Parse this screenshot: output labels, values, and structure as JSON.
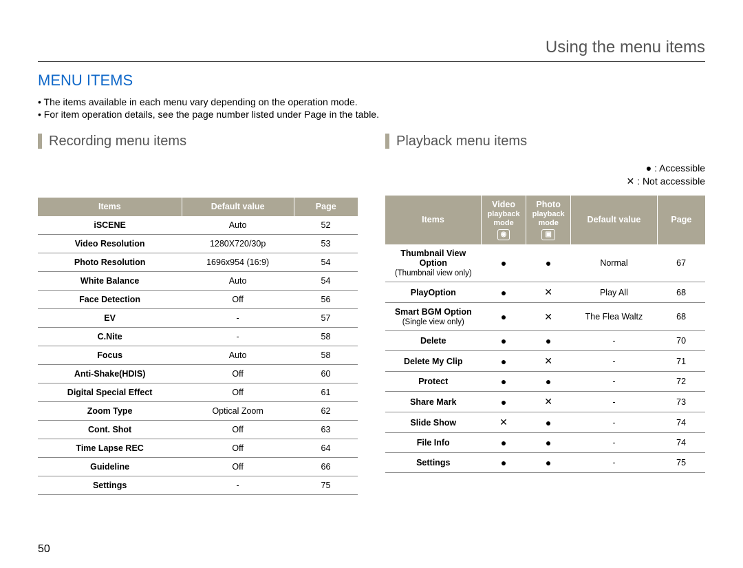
{
  "header": {
    "top_title": "Using the menu items",
    "section_title": "MENU ITEMS"
  },
  "bullets": [
    "The items available in each menu vary depending on the operation mode.",
    "For item operation details, see the page number listed under Page in the table."
  ],
  "page_number": "50",
  "left": {
    "title": "Recording menu items",
    "headers": {
      "c1": "Items",
      "c2": "Default value",
      "c3": "Page"
    },
    "rows": [
      {
        "item": "iSCENE",
        "value": "Auto",
        "page": "52"
      },
      {
        "item": "Video Resolution",
        "value": "1280X720/30p",
        "page": "53"
      },
      {
        "item": "Photo Resolution",
        "value": "1696x954 (16:9)",
        "page": "54"
      },
      {
        "item": "White Balance",
        "value": "Auto",
        "page": "54"
      },
      {
        "item": "Face Detection",
        "value": "Off",
        "page": "56"
      },
      {
        "item": "EV",
        "value": "-",
        "page": "57"
      },
      {
        "item": "C.Nite",
        "value": "-",
        "page": "58"
      },
      {
        "item": "Focus",
        "value": "Auto",
        "page": "58"
      },
      {
        "item": "Anti-Shake(HDIS)",
        "value": "Off",
        "page": "60"
      },
      {
        "item": "Digital Special Effect",
        "value": "Off",
        "page": "61"
      },
      {
        "item": "Zoom Type",
        "value": "Optical Zoom",
        "page": "62"
      },
      {
        "item": "Cont. Shot",
        "value": "Off",
        "page": "63"
      },
      {
        "item": "Time Lapse REC",
        "value": "Off",
        "page": "64"
      },
      {
        "item": "Guideline",
        "value": "Off",
        "page": "66"
      },
      {
        "item": "Settings",
        "value": "-",
        "page": "75"
      }
    ]
  },
  "right": {
    "title": "Playback menu items",
    "legend": {
      "accessible": "● : Accessible",
      "not_accessible": "✕ : Not accessible"
    },
    "headers": {
      "c1": "Items",
      "c2a": "Video",
      "c2b": "playback",
      "c2c": "mode",
      "c3a": "Photo",
      "c3b": "playback",
      "c3c": "mode",
      "c4": "Default value",
      "c5": "Page"
    },
    "rows": [
      {
        "item": "Thumbnail View Option",
        "note": "(Thumbnail view only)",
        "v": "●",
        "p": "●",
        "def": "Normal",
        "page": "67"
      },
      {
        "item": "PlayOption",
        "note": "",
        "v": "●",
        "p": "✕",
        "def": "Play All",
        "page": "68"
      },
      {
        "item": "Smart BGM Option",
        "note": "(Single view only)",
        "v": "●",
        "p": "✕",
        "def": "The Flea Waltz",
        "page": "68"
      },
      {
        "item": "Delete",
        "note": "",
        "v": "●",
        "p": "●",
        "def": "-",
        "page": "70"
      },
      {
        "item": "Delete My Clip",
        "note": "",
        "v": "●",
        "p": "✕",
        "def": "-",
        "page": "71"
      },
      {
        "item": "Protect",
        "note": "",
        "v": "●",
        "p": "●",
        "def": "-",
        "page": "72"
      },
      {
        "item": "Share Mark",
        "note": "",
        "v": "●",
        "p": "✕",
        "def": "-",
        "page": "73"
      },
      {
        "item": "Slide Show",
        "note": "",
        "v": "✕",
        "p": "●",
        "def": "-",
        "page": "74"
      },
      {
        "item": "File Info",
        "note": "",
        "v": "●",
        "p": "●",
        "def": "-",
        "page": "74"
      },
      {
        "item": "Settings",
        "note": "",
        "v": "●",
        "p": "●",
        "def": "-",
        "page": "75"
      }
    ]
  }
}
